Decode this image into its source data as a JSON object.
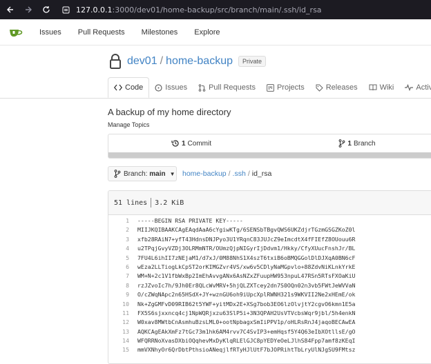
{
  "browser": {
    "url_host": "127.0.0.1",
    "url_path": ":3000/dev01/home-backup/src/branch/main/.ssh/id_rsa"
  },
  "header": {
    "menu": [
      "Issues",
      "Pull Requests",
      "Milestones",
      "Explore"
    ]
  },
  "repo": {
    "owner": "dev01",
    "separator": "/",
    "name": "home-backup",
    "visibility": "Private"
  },
  "tabs": [
    {
      "label": "Code",
      "icon": "code-icon",
      "active": true
    },
    {
      "label": "Issues",
      "icon": "issue-icon"
    },
    {
      "label": "Pull Requests",
      "icon": "pull-request-icon"
    },
    {
      "label": "Projects",
      "icon": "project-icon"
    },
    {
      "label": "Releases",
      "icon": "tag-icon"
    },
    {
      "label": "Wiki",
      "icon": "book-icon"
    },
    {
      "label": "Activity",
      "icon": "pulse-icon"
    }
  ],
  "description": "A backup of my home directory",
  "manage_topics": "Manage Topics",
  "stats": {
    "commits_count": "1",
    "commits_label": "Commit",
    "branches_count": "1",
    "branches_label": "Branch"
  },
  "branch_selector": {
    "prefix": "Branch:",
    "value": "main"
  },
  "breadcrumb": [
    "home-backup",
    ".ssh",
    "id_rsa"
  ],
  "file": {
    "lines_info": "51 lines",
    "size": "3.2 KiB",
    "lines": [
      "-----BEGIN RSA PRIVATE KEY-----",
      "MIIJKQIBAAKCAgEAqdAaA6cYgiwKTg/6SENSbTBgvQWS6UKZdjrTGzmGSGZKoZ0l",
      "xfb28RAiN7+yfT43HdnsDNJPyo3U1YRqnC83JUJcZ9eImcdtX4fFIEfZ8OUouu6R",
      "u2TPqjGvyVZDj3OLRMmNTR/OUmzQjpNIGyrIjDdvm1/Hkky/CfyXUucFnshJr/BL",
      "7FU4L6ihII7zNEjaM1/d7xJ/0M88NhS1X4szT6txiB6oBMQGGolDlDJXqA0BN6cF",
      "wEza2LLTiogLkCpST2orKIMGZvr4VS/xw6v5CDlyNaMGpvlo+88ZdvNiKLnkYrkE",
      "WM+N+2c1V1fbWxBp2ImEhAvvgANx6AsNZxZFuupHW953npuL47RSn5RTsFXOaKiU",
      "rzJZvoIc7h/9Jh0Er8QLcWvMRV+5hjQLZXTcey2dn7S0OQn02n3vb5FWtJeWVVaN",
      "O/cZWqNApc2n65HSdX+JY+wznGU6oh9iUpcXplRWNH321s9WKVII2Ne2xHEmE/ok",
      "Nk+ZgGMFvD09RIB62t5YWF+yitMDx2E+XSg7bob3EO6lzOlvjtY2cgvO6kmn1E5a",
      "FX5S6sjxxncq4cj1NpWQRjxzu63SlP5i+3N3QPAH2UsVTVcbsWqr9jbl/5h4enkN",
      "W0xav8MWtbCnAsmhuBzsLML0+ootNpbagxSmIiPPV1p/oHLRsRnJ4jaqoBECAwEA",
      "AQKCAgEAkXmFz7tGc73m1hk6AM4rvv7C4SvIP3+emHqsf5Y4Q63eIbXOtllsE/gO",
      "WFQRRNoXvasDXbiOQqhevMxDyKlqRLElGJC8pYEDYeOeLJlhS84Fpp7amf8zKEqI",
      "mmVXNhyOr6QrDbtPthsioANeqjlfRTyHJlUtF7bJOPRihtTbLryUlNJgSU9FMtsz"
    ]
  },
  "colors": {
    "link": "#4183c4",
    "logo": "#609926",
    "browser_bar": "#1c1b22"
  }
}
